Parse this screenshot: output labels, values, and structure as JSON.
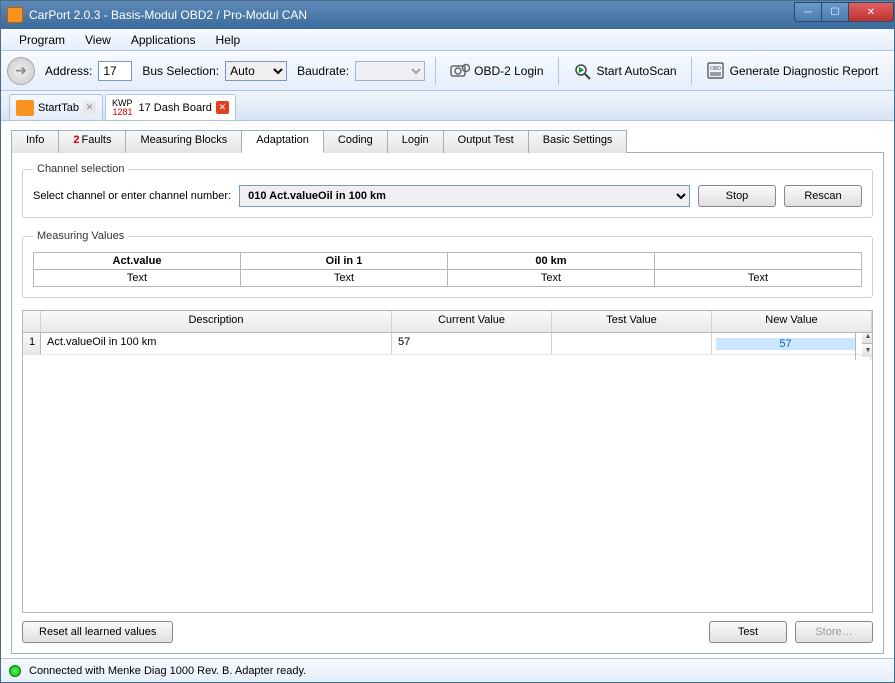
{
  "title": "CarPort 2.0.3  - Basis-Modul OBD2 / Pro-Modul CAN",
  "menu": {
    "program": "Program",
    "view": "View",
    "applications": "Applications",
    "help": "Help"
  },
  "toolbar": {
    "address_label": "Address:",
    "address_value": "17",
    "bus_label": "Bus Selection:",
    "bus_value": "Auto",
    "baud_label": "Baudrate:",
    "baud_value": "",
    "obd_login": "OBD-2 Login",
    "autoscan": "Start AutoScan",
    "report": "Generate Diagnostic Report"
  },
  "doc_tabs": {
    "start": "StartTab",
    "kwp_top": "KWP",
    "kwp_bottom": "1281",
    "dash": "17 Dash Board"
  },
  "subtabs": {
    "info": "Info",
    "faults_count": "2",
    "faults": "Faults",
    "mblocks": "Measuring Blocks",
    "adaptation": "Adaptation",
    "coding": "Coding",
    "login": "Login",
    "output": "Output Test",
    "basic": "Basic Settings"
  },
  "channel": {
    "legend": "Channel selection",
    "label": "Select channel or enter channel number:",
    "value": "010 Act.valueOil in 100 km",
    "stop": "Stop",
    "rescan": "Rescan"
  },
  "measuring": {
    "legend": "Measuring Values",
    "c1h": "Act.value",
    "c1v": "Text",
    "c2h": "Oil in 1",
    "c2v": "Text",
    "c3h": "00 km",
    "c3v": "Text",
    "c4h": "",
    "c4v": "Text"
  },
  "grid": {
    "h_desc": "Description",
    "h_cv": "Current Value",
    "h_tv": "Test Value",
    "h_nv": "New Value",
    "row1": {
      "n": "1",
      "desc": "Act.valueOil in 100 km",
      "cv": "57",
      "tv": "",
      "nv": "57"
    }
  },
  "footer": {
    "reset": "Reset all learned values",
    "test": "Test",
    "store": "Store…"
  },
  "status": "Connected with Menke Diag 1000 Rev. B. Adapter ready."
}
